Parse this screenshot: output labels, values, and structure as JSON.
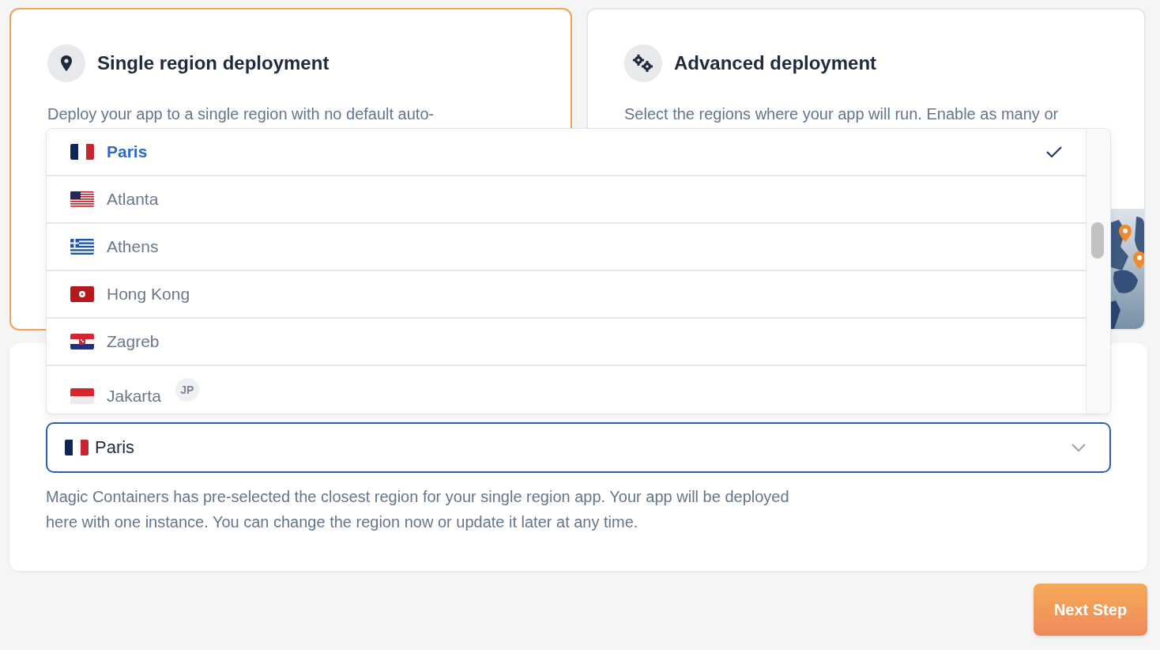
{
  "deployment_options": [
    {
      "kind": "single",
      "title": "Single region deployment",
      "description": "Deploy your app to a single region with no default auto-",
      "selected": true
    },
    {
      "kind": "advanced",
      "title": "Advanced deployment",
      "description": "Select the regions where your app will run. Enable as many or",
      "selected": false
    }
  ],
  "region_dropdown": {
    "options": [
      {
        "kind": "fr",
        "name": "Paris",
        "selected": true
      },
      {
        "kind": "us",
        "name": "Atlanta",
        "selected": false
      },
      {
        "kind": "gr",
        "name": "Athens",
        "selected": false
      },
      {
        "kind": "hk",
        "name": "Hong Kong",
        "selected": false
      },
      {
        "kind": "hr",
        "name": "Zagreb",
        "selected": false
      },
      {
        "kind": "id",
        "name": "Jakarta",
        "selected": false,
        "badge": "JP"
      }
    ]
  },
  "region_select": {
    "kind": "fr",
    "value": "Paris",
    "help": "Magic Containers has pre-selected the closest region for your single region app. Your app will be deployed here with one instance. You can change the region now or update it later at any time."
  },
  "next_button": "Next Step"
}
